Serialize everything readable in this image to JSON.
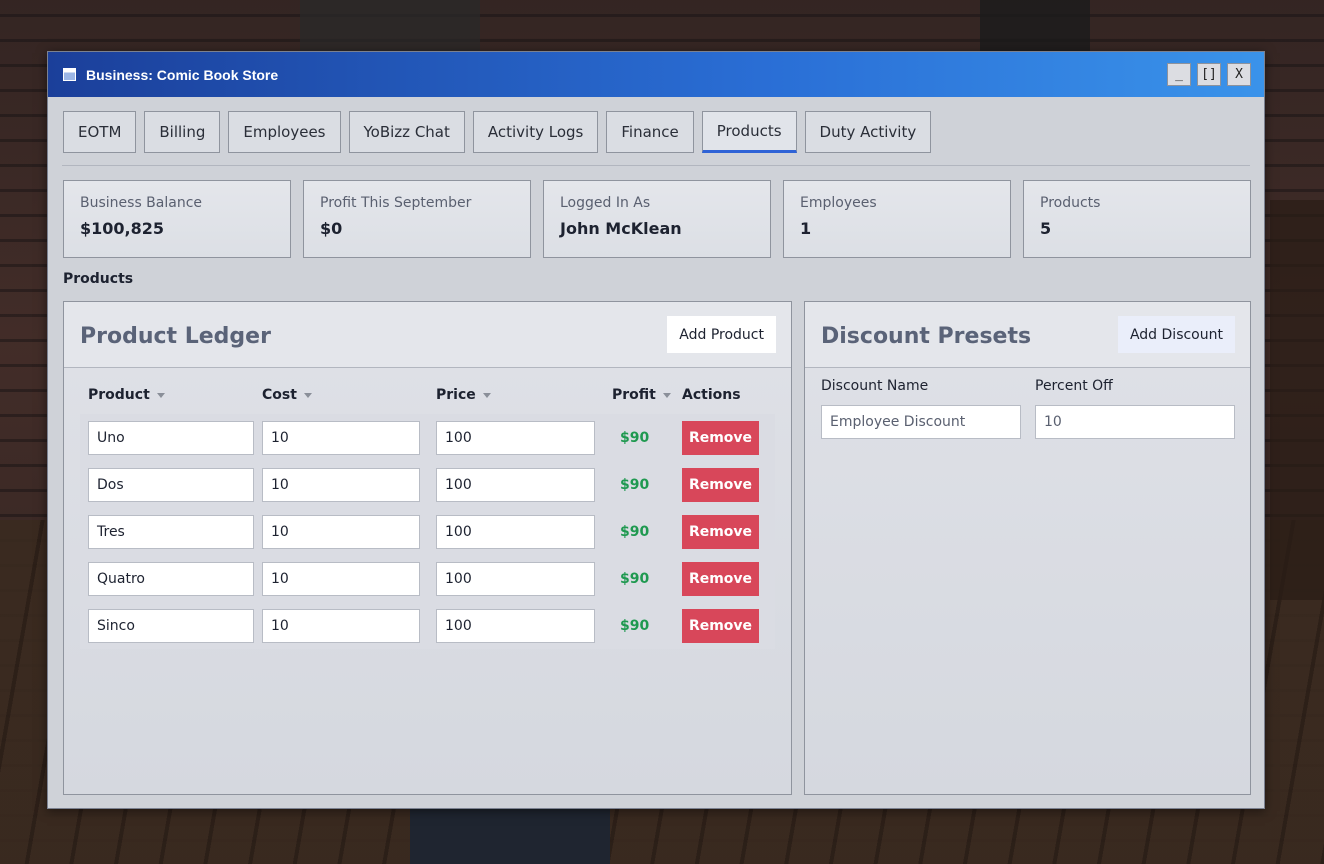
{
  "window": {
    "title": "Business: Comic Book Store",
    "controls": {
      "minimize": "_",
      "maximize": "[]",
      "close": "X"
    }
  },
  "tabs": [
    {
      "label": "EOTM"
    },
    {
      "label": "Billing"
    },
    {
      "label": "Employees"
    },
    {
      "label": "YoBizz Chat"
    },
    {
      "label": "Activity Logs"
    },
    {
      "label": "Finance"
    },
    {
      "label": "Products",
      "active": true
    },
    {
      "label": "Duty Activity"
    }
  ],
  "stats": [
    {
      "label": "Business Balance",
      "value": "$100,825"
    },
    {
      "label": "Profit This September",
      "value": "$0"
    },
    {
      "label": "Logged In As",
      "value": "John McKlean"
    },
    {
      "label": "Employees",
      "value": "1"
    },
    {
      "label": "Products",
      "value": "5"
    }
  ],
  "section_label": "Products",
  "ledger": {
    "title": "Product Ledger",
    "add_label": "Add Product",
    "columns": {
      "product": "Product",
      "cost": "Cost",
      "price": "Price",
      "profit": "Profit",
      "actions": "Actions"
    },
    "remove_label": "Remove",
    "rows": [
      {
        "product": "Uno",
        "cost": "10",
        "price": "100",
        "profit": "$90"
      },
      {
        "product": "Dos",
        "cost": "10",
        "price": "100",
        "profit": "$90"
      },
      {
        "product": "Tres",
        "cost": "10",
        "price": "100",
        "profit": "$90"
      },
      {
        "product": "Quatro",
        "cost": "10",
        "price": "100",
        "profit": "$90"
      },
      {
        "product": "Sinco",
        "cost": "10",
        "price": "100",
        "profit": "$90"
      }
    ]
  },
  "discounts": {
    "title": "Discount Presets",
    "add_label": "Add Discount",
    "name_label": "Discount Name",
    "percent_label": "Percent Off",
    "name_placeholder": "Employee Discount",
    "percent_placeholder": "10"
  },
  "colors": {
    "title_bar_start": "#1b3f9a",
    "title_bar_end": "#3a93ea",
    "active_tab_underline": "#2f63d6",
    "profit_green": "#1f9950",
    "remove_red": "#d8475a"
  }
}
